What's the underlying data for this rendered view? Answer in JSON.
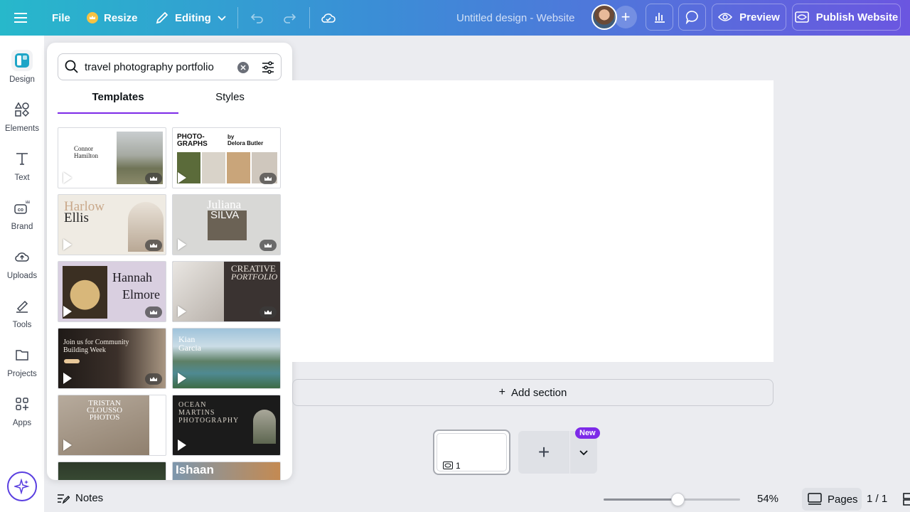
{
  "topbar": {
    "file_label": "File",
    "resize_label": "Resize",
    "editing_label": "Editing",
    "doc_title": "Untitled design - Website",
    "preview_label": "Preview",
    "publish_label": "Publish Website"
  },
  "rail": {
    "items": [
      {
        "label": "Design",
        "icon": "design-icon"
      },
      {
        "label": "Elements",
        "icon": "elements-icon"
      },
      {
        "label": "Text",
        "icon": "text-icon"
      },
      {
        "label": "Brand",
        "icon": "brand-icon"
      },
      {
        "label": "Uploads",
        "icon": "uploads-icon"
      },
      {
        "label": "Tools",
        "icon": "tools-icon"
      },
      {
        "label": "Projects",
        "icon": "projects-icon"
      },
      {
        "label": "Apps",
        "icon": "apps-icon"
      }
    ]
  },
  "panel": {
    "search_value": "travel photography portfolio",
    "tab_templates": "Templates",
    "tab_styles": "Styles",
    "templates": [
      {
        "title": "Connor\nHamilton"
      },
      {
        "title": "PHOTO-\nGRAPHS",
        "subtitle": "by\nDelora Butler"
      },
      {
        "title": "Harlow",
        "title2": "Ellis"
      },
      {
        "title": "Juliana",
        "title2": "SILVA"
      },
      {
        "title": "Hannah",
        "title2": "Elmore"
      },
      {
        "title": "CREATIVE",
        "title2": "PORTFOLIO"
      },
      {
        "title": "Join us for Community\nBuilding Week"
      },
      {
        "title": "Kian\nGarcia"
      },
      {
        "title": "TRISTAN\nCLOUSSO\nPHOTOS"
      },
      {
        "title": "OCEAN\nMARTINS\nPHOTOGRAPHY"
      },
      {
        "title": ""
      },
      {
        "title": "Ishaan"
      }
    ]
  },
  "canvas": {
    "add_section_label": "Add section",
    "page_number": "1",
    "new_badge": "New"
  },
  "bottombar": {
    "notes_label": "Notes",
    "zoom_percent": "54%",
    "zoom_level": 0.54,
    "pages_label": "Pages",
    "page_count": "1 / 1"
  },
  "colors": {
    "accent": "#7d2ae8",
    "magic": "#5a3fe0"
  }
}
